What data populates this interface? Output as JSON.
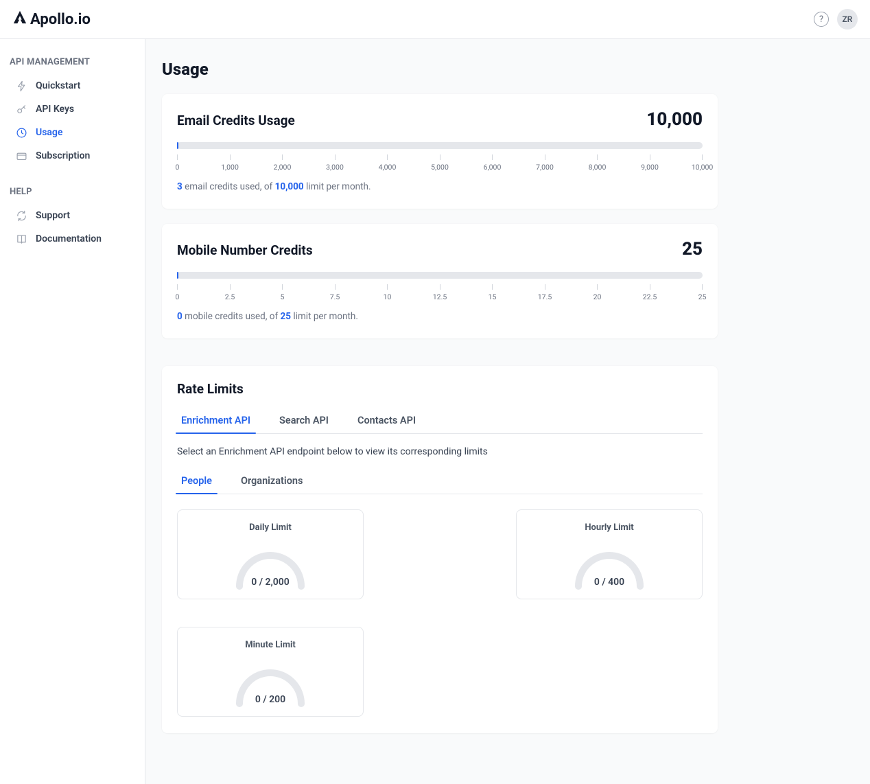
{
  "header": {
    "logo_text": "Apollo.io",
    "avatar_initials": "ZR"
  },
  "sidebar": {
    "sections": [
      {
        "title": "API MANAGEMENT",
        "items": [
          {
            "id": "quickstart",
            "label": "Quickstart",
            "icon": "lightning",
            "active": false
          },
          {
            "id": "apikeys",
            "label": "API Keys",
            "icon": "key",
            "active": false
          },
          {
            "id": "usage",
            "label": "Usage",
            "icon": "clock",
            "active": true
          },
          {
            "id": "subscription",
            "label": "Subscription",
            "icon": "creditcard",
            "active": false
          }
        ]
      },
      {
        "title": "HELP",
        "items": [
          {
            "id": "support",
            "label": "Support",
            "icon": "refresh",
            "active": false
          },
          {
            "id": "documentation",
            "label": "Documentation",
            "icon": "book",
            "active": false
          }
        ]
      }
    ]
  },
  "page": {
    "title": "Usage"
  },
  "usage_cards": [
    {
      "id": "email",
      "title": "Email Credits Usage",
      "limit_display": "10,000",
      "used_display": "3",
      "unit_text": "email credits used, of",
      "limit_inline": "10,000",
      "limit_suffix": "limit per month.",
      "scale": [
        "0",
        "1,000",
        "2,000",
        "3,000",
        "4,000",
        "5,000",
        "6,000",
        "7,000",
        "8,000",
        "9,000",
        "10,000"
      ],
      "fill_percent": 0.3
    },
    {
      "id": "mobile",
      "title": "Mobile Number Credits",
      "limit_display": "25",
      "used_display": "0",
      "unit_text": "mobile credits used, of",
      "limit_inline": "25",
      "limit_suffix": "limit per month.",
      "scale": [
        "0",
        "2.5",
        "5",
        "7.5",
        "10",
        "12.5",
        "15",
        "17.5",
        "20",
        "22.5",
        "25"
      ],
      "fill_percent": 0
    }
  ],
  "rate_limits": {
    "title": "Rate Limits",
    "api_tabs": [
      {
        "id": "enrich",
        "label": "Enrichment API",
        "active": true
      },
      {
        "id": "search",
        "label": "Search API",
        "active": false
      },
      {
        "id": "contacts",
        "label": "Contacts API",
        "active": false
      }
    ],
    "description": "Select an Enrichment API endpoint below to view its corresponding limits",
    "sub_tabs": [
      {
        "id": "people",
        "label": "People",
        "active": true
      },
      {
        "id": "orgs",
        "label": "Organizations",
        "active": false
      }
    ],
    "gauges": [
      {
        "id": "daily",
        "title": "Daily Limit",
        "value": "0 / 2,000"
      },
      {
        "id": "hourly",
        "title": "Hourly Limit",
        "value": "0 / 400"
      },
      {
        "id": "minute",
        "title": "Minute Limit",
        "value": "0 / 200"
      }
    ]
  },
  "chart_data": [
    {
      "type": "bar",
      "title": "Email Credits Usage",
      "x": [
        0,
        1000,
        2000,
        3000,
        4000,
        5000,
        6000,
        7000,
        8000,
        9000,
        10000
      ],
      "value": 3,
      "limit": 10000,
      "xlim": [
        0,
        10000
      ]
    },
    {
      "type": "bar",
      "title": "Mobile Number Credits",
      "x": [
        0,
        2.5,
        5,
        7.5,
        10,
        12.5,
        15,
        17.5,
        20,
        22.5,
        25
      ],
      "value": 0,
      "limit": 25,
      "xlim": [
        0,
        25
      ]
    },
    {
      "type": "area",
      "title": "Daily Limit",
      "value": 0,
      "limit": 2000,
      "ylim": [
        0,
        2000
      ]
    },
    {
      "type": "area",
      "title": "Hourly Limit",
      "value": 0,
      "limit": 400,
      "ylim": [
        0,
        400
      ]
    },
    {
      "type": "area",
      "title": "Minute Limit",
      "value": 0,
      "limit": 200,
      "ylim": [
        0,
        200
      ]
    }
  ]
}
